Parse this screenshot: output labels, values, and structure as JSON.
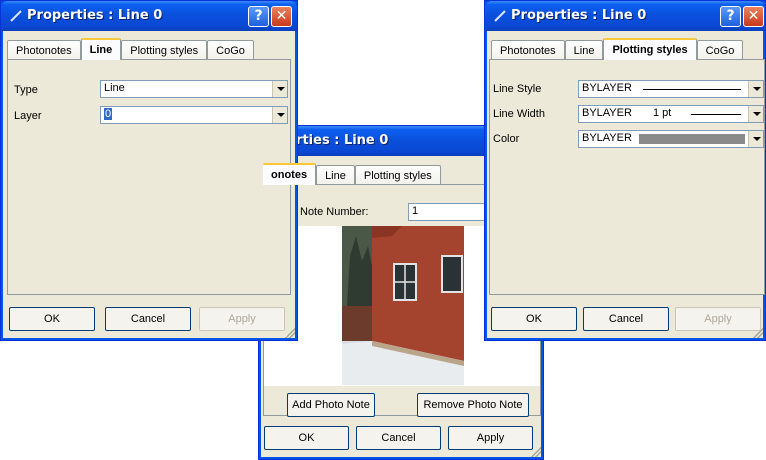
{
  "windows": {
    "left": {
      "title": "Properties : Line 0",
      "tabs": [
        "Photonotes",
        "Line",
        "Plotting styles",
        "CoGo"
      ],
      "fields": {
        "type_label": "Type",
        "type_value": "Line",
        "layer_label": "Layer",
        "layer_value": "0"
      },
      "buttons": {
        "ok": "OK",
        "cancel": "Cancel",
        "apply": "Apply"
      }
    },
    "middle": {
      "title": "operties : Line 0",
      "tabs": [
        "onotes",
        "Line",
        "Plotting styles"
      ],
      "note_label": "Note Number:",
      "note_value": "1",
      "add_button": "Add Photo Note",
      "remove_button": "Remove Photo Note",
      "buttons": {
        "ok": "OK",
        "cancel": "Cancel",
        "apply": "Apply"
      }
    },
    "right": {
      "title": "Properties : Line 0",
      "tabs": [
        "Photonotes",
        "Line",
        "Plotting styles",
        "CoGo"
      ],
      "fields": {
        "line_style_label": "Line Style",
        "line_style_value": "BYLAYER",
        "line_width_label": "Line Width",
        "line_width_value": "BYLAYER",
        "line_width_pt": "1 pt",
        "color_label": "Color",
        "color_value": "BYLAYER"
      },
      "buttons": {
        "ok": "OK",
        "cancel": "Cancel",
        "apply": "Apply"
      }
    }
  },
  "colors": {
    "title_bar": "#0a4fdc",
    "window_face": "#ece9d8",
    "active_tab_highlight": "#ffc83c",
    "color_swatch": "#8a8a8a"
  },
  "icons": [
    "properties-icon",
    "help-icon",
    "close-icon",
    "dropdown-arrow-icon"
  ]
}
